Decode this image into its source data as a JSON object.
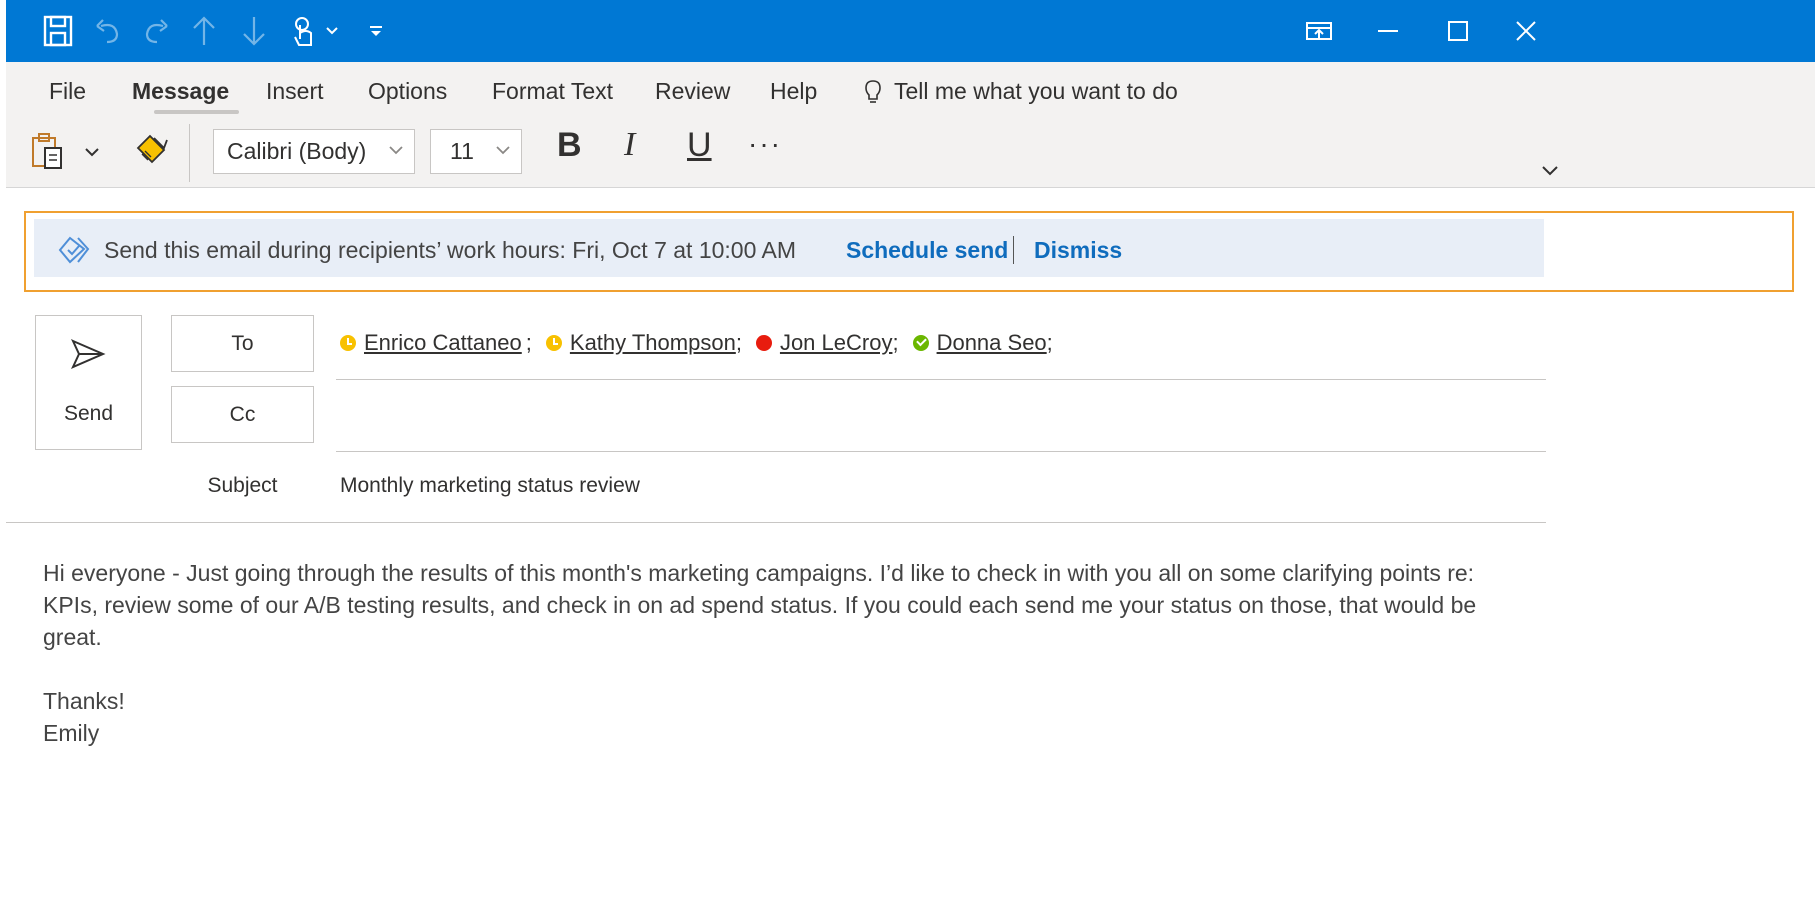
{
  "titlebar": {
    "icons": [
      "save-icon",
      "undo-icon",
      "redo-icon",
      "up-arrow-icon",
      "down-arrow-icon",
      "touch-mode-icon",
      "customize-toolbar-icon",
      "ribbon-display-icon",
      "minimize-icon",
      "maximize-icon",
      "close-icon"
    ],
    "background": "#0078d4"
  },
  "ribbon": {
    "tabs": [
      {
        "label": "File"
      },
      {
        "label": "Message"
      },
      {
        "label": "Insert"
      },
      {
        "label": "Options"
      },
      {
        "label": "Format Text"
      },
      {
        "label": "Review"
      },
      {
        "label": "Help"
      }
    ],
    "active_tab": "Message",
    "tell_me": "Tell me what you want to do",
    "font_name": "Calibri (Body)",
    "font_size": "11",
    "bold": "B",
    "italic": "I",
    "underline": "U",
    "more": "···"
  },
  "infobar": {
    "message": "Send this email during recipients’ work hours: Fri, Oct 7 at 10:00 AM",
    "schedule_send": "Schedule send",
    "dismiss": "Dismiss",
    "highlight_color": "#f0a030"
  },
  "compose": {
    "send_label": "Send",
    "to_label": "To",
    "cc_label": "Cc",
    "subject_label": "Subject",
    "subject": "Monthly marketing status review",
    "recipients": [
      {
        "name": "Enrico Cattaneo",
        "status": "away",
        "sep": ";"
      },
      {
        "name": "Kathy Thompson",
        "status": "away",
        "sep": ";"
      },
      {
        "name": "Jon LeCroy",
        "status": "busy",
        "sep": ";"
      },
      {
        "name": "Donna Seo",
        "status": "available",
        "sep": ";"
      }
    ]
  },
  "body": {
    "paragraph": "Hi everyone - Just going through the results of this month's marketing campaigns. I’d like to check in with you all on some clarifying points re: KPIs, review some of our A/B testing results, and check in on ad spend status. If you could each send me your status on those, that would be great.",
    "closing": "Thanks!",
    "signature": "Emily"
  }
}
